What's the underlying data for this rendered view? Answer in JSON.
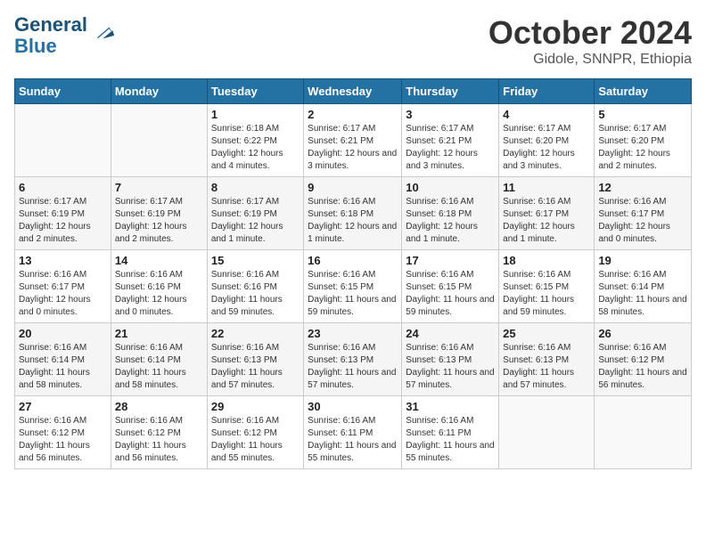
{
  "header": {
    "logo_line1": "General",
    "logo_line2": "Blue",
    "title": "October 2024",
    "subtitle": "Gidole, SNNPR, Ethiopia"
  },
  "weekdays": [
    "Sunday",
    "Monday",
    "Tuesday",
    "Wednesday",
    "Thursday",
    "Friday",
    "Saturday"
  ],
  "weeks": [
    [
      {
        "day": "",
        "info": ""
      },
      {
        "day": "",
        "info": ""
      },
      {
        "day": "1",
        "info": "Sunrise: 6:18 AM\nSunset: 6:22 PM\nDaylight: 12 hours and 4 minutes."
      },
      {
        "day": "2",
        "info": "Sunrise: 6:17 AM\nSunset: 6:21 PM\nDaylight: 12 hours and 3 minutes."
      },
      {
        "day": "3",
        "info": "Sunrise: 6:17 AM\nSunset: 6:21 PM\nDaylight: 12 hours and 3 minutes."
      },
      {
        "day": "4",
        "info": "Sunrise: 6:17 AM\nSunset: 6:20 PM\nDaylight: 12 hours and 3 minutes."
      },
      {
        "day": "5",
        "info": "Sunrise: 6:17 AM\nSunset: 6:20 PM\nDaylight: 12 hours and 2 minutes."
      }
    ],
    [
      {
        "day": "6",
        "info": "Sunrise: 6:17 AM\nSunset: 6:19 PM\nDaylight: 12 hours and 2 minutes."
      },
      {
        "day": "7",
        "info": "Sunrise: 6:17 AM\nSunset: 6:19 PM\nDaylight: 12 hours and 2 minutes."
      },
      {
        "day": "8",
        "info": "Sunrise: 6:17 AM\nSunset: 6:19 PM\nDaylight: 12 hours and 1 minute."
      },
      {
        "day": "9",
        "info": "Sunrise: 6:16 AM\nSunset: 6:18 PM\nDaylight: 12 hours and 1 minute."
      },
      {
        "day": "10",
        "info": "Sunrise: 6:16 AM\nSunset: 6:18 PM\nDaylight: 12 hours and 1 minute."
      },
      {
        "day": "11",
        "info": "Sunrise: 6:16 AM\nSunset: 6:17 PM\nDaylight: 12 hours and 1 minute."
      },
      {
        "day": "12",
        "info": "Sunrise: 6:16 AM\nSunset: 6:17 PM\nDaylight: 12 hours and 0 minutes."
      }
    ],
    [
      {
        "day": "13",
        "info": "Sunrise: 6:16 AM\nSunset: 6:17 PM\nDaylight: 12 hours and 0 minutes."
      },
      {
        "day": "14",
        "info": "Sunrise: 6:16 AM\nSunset: 6:16 PM\nDaylight: 12 hours and 0 minutes."
      },
      {
        "day": "15",
        "info": "Sunrise: 6:16 AM\nSunset: 6:16 PM\nDaylight: 11 hours and 59 minutes."
      },
      {
        "day": "16",
        "info": "Sunrise: 6:16 AM\nSunset: 6:15 PM\nDaylight: 11 hours and 59 minutes."
      },
      {
        "day": "17",
        "info": "Sunrise: 6:16 AM\nSunset: 6:15 PM\nDaylight: 11 hours and 59 minutes."
      },
      {
        "day": "18",
        "info": "Sunrise: 6:16 AM\nSunset: 6:15 PM\nDaylight: 11 hours and 59 minutes."
      },
      {
        "day": "19",
        "info": "Sunrise: 6:16 AM\nSunset: 6:14 PM\nDaylight: 11 hours and 58 minutes."
      }
    ],
    [
      {
        "day": "20",
        "info": "Sunrise: 6:16 AM\nSunset: 6:14 PM\nDaylight: 11 hours and 58 minutes."
      },
      {
        "day": "21",
        "info": "Sunrise: 6:16 AM\nSunset: 6:14 PM\nDaylight: 11 hours and 58 minutes."
      },
      {
        "day": "22",
        "info": "Sunrise: 6:16 AM\nSunset: 6:13 PM\nDaylight: 11 hours and 57 minutes."
      },
      {
        "day": "23",
        "info": "Sunrise: 6:16 AM\nSunset: 6:13 PM\nDaylight: 11 hours and 57 minutes."
      },
      {
        "day": "24",
        "info": "Sunrise: 6:16 AM\nSunset: 6:13 PM\nDaylight: 11 hours and 57 minutes."
      },
      {
        "day": "25",
        "info": "Sunrise: 6:16 AM\nSunset: 6:13 PM\nDaylight: 11 hours and 57 minutes."
      },
      {
        "day": "26",
        "info": "Sunrise: 6:16 AM\nSunset: 6:12 PM\nDaylight: 11 hours and 56 minutes."
      }
    ],
    [
      {
        "day": "27",
        "info": "Sunrise: 6:16 AM\nSunset: 6:12 PM\nDaylight: 11 hours and 56 minutes."
      },
      {
        "day": "28",
        "info": "Sunrise: 6:16 AM\nSunset: 6:12 PM\nDaylight: 11 hours and 56 minutes."
      },
      {
        "day": "29",
        "info": "Sunrise: 6:16 AM\nSunset: 6:12 PM\nDaylight: 11 hours and 55 minutes."
      },
      {
        "day": "30",
        "info": "Sunrise: 6:16 AM\nSunset: 6:11 PM\nDaylight: 11 hours and 55 minutes."
      },
      {
        "day": "31",
        "info": "Sunrise: 6:16 AM\nSunset: 6:11 PM\nDaylight: 11 hours and 55 minutes."
      },
      {
        "day": "",
        "info": ""
      },
      {
        "day": "",
        "info": ""
      }
    ]
  ]
}
